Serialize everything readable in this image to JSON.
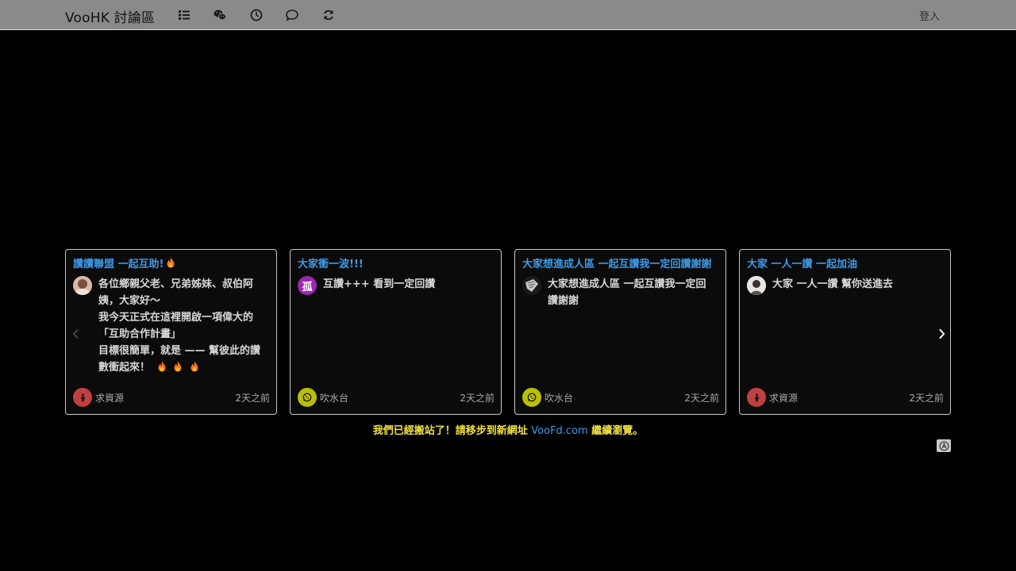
{
  "navbar": {
    "brand": "VooHK 討論區",
    "icons": [
      "list-icon",
      "wechat-icon",
      "clock-icon",
      "chat-icon",
      "refresh-icon"
    ],
    "login_label": "登入",
    "bg_color": "#8a8a8a"
  },
  "cards": [
    {
      "title": "讚讚聯盟 一起互助!",
      "has_flame": true,
      "body_lines": [
        "各位鄉親父老、兄弟姊妹、叔伯阿",
        "姨，大家好～",
        "我今天正式在這裡開啟一項偉大的",
        "「互助合作計畫」",
        "目標很簡單，就是 —— 幫彼此的讚",
        "數衝起來！"
      ],
      "body_flames": 3,
      "avatar": "photo-avatar",
      "category": "求資源",
      "category_icon": "person-icon",
      "category_color": "#c04040",
      "time": "2天之前"
    },
    {
      "title": "大家衝一波!!!",
      "has_flame": false,
      "body_lines": [
        "互讚+++ 看到一定回讚"
      ],
      "body_flames": 0,
      "avatar": "孤",
      "avatar_color": "#9c27b0",
      "category": "吹水台",
      "category_icon": "whatsapp-icon",
      "category_color": "#b8c000",
      "time": "2天之前"
    },
    {
      "title": "大家想進成人區 一起互讚我一定回讚謝謝",
      "has_flame": false,
      "body_lines": [
        "大家想進成人區 一起互讚我一定回",
        "讚謝謝"
      ],
      "body_flames": 0,
      "avatar": "photo-avatar",
      "category": "吹水台",
      "category_icon": "whatsapp-icon",
      "category_color": "#b8c000",
      "time": "2天之前"
    },
    {
      "title": "大家 一人一讚 一起加油",
      "has_flame": false,
      "body_lines": [
        "大家 一人一讚 幫你送進去"
      ],
      "body_flames": 0,
      "avatar": "photo-avatar",
      "category": "求資源",
      "category_icon": "person-icon",
      "category_color": "#c04040",
      "time": "2天之前"
    }
  ],
  "notice": {
    "prefix": "我們已經搬站了！請移步到新網址 ",
    "link": "VooFd.com",
    "suffix": " 繼續瀏覽。"
  },
  "colors": {
    "link": "#3d9be9",
    "notice": "#f0e040"
  }
}
